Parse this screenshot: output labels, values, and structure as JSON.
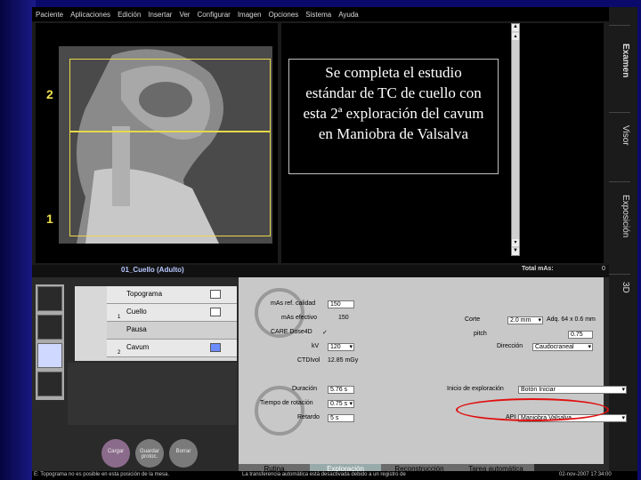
{
  "menu": [
    "Paciente",
    "Aplicaciones",
    "Edición",
    "Insertar",
    "Ver",
    "Configurar",
    "Imagen",
    "Opciones",
    "Sistema",
    "Ayuda"
  ],
  "viewer": {
    "label_2": "2",
    "label_1": "1"
  },
  "callout": "Se completa el estudio estándar de TC de cuello con esta 2ª exploración del cavum en Maniobra de Valsalva",
  "side_tabs": {
    "examen": "Examen",
    "visor": "Visor",
    "exposicion": "Exposición",
    "d3": "3D"
  },
  "protocol": {
    "title": "01_Cuello (Adulto)",
    "total_mas_label": "Total mAs:",
    "total_mas_value": "0"
  },
  "steps": [
    {
      "label": "Topograma",
      "num": ""
    },
    {
      "label": "Cuello",
      "num": "1"
    },
    {
      "label": "Pausa",
      "num": ""
    },
    {
      "label": "Cavum",
      "num": "2"
    }
  ],
  "buttons": {
    "cargar": "Cargar",
    "guardar": "Guardar protoc.",
    "borrar": "Borrar"
  },
  "params_left": {
    "mas_label": "mAs ref. calidad",
    "mas_value": "150",
    "mas_eff_label": "mAs efectivo",
    "mas_eff_value": "150",
    "care_label": "CARE Dose4D",
    "care_value": "✓",
    "kv_label": "kV",
    "kv_value": "120",
    "ctdi_label": "CTDIvol",
    "ctdi_value": "12.85 mGy",
    "dur_label": "Duración",
    "dur_value": "5.76 s",
    "rot_label": "Tiempo de rotación",
    "rot_value": "0.75 s",
    "ret_label": "Retardo",
    "ret_value": "5 s"
  },
  "params_right": {
    "corte_label": "Corte",
    "corte_value": "2.0 mm",
    "adq": "Adq. 64 x 0.6 mm",
    "pitch_label": "pitch",
    "pitch_value": "0.75",
    "dir_label": "Dirección",
    "dir_value": "Caudocraneal",
    "inicio_label": "Inicio de exploración",
    "inicio_value": "Botón Iniciar",
    "api_label": "API",
    "api_value": "Maniobra Valsalva"
  },
  "bottom_tabs": [
    "Rutina",
    "Exploración",
    "Reconstrucción",
    "Tarea automática"
  ],
  "status": {
    "left": "E: Topograma no es posible en esta posición de la mesa.",
    "mid": "La transferencia automática está desactivada debido a un registro de",
    "right": "02-nov-2007 17:34:00"
  }
}
